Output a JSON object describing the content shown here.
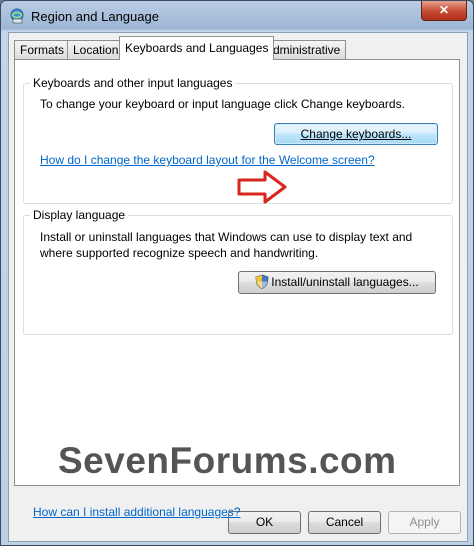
{
  "window": {
    "title": "Region and Language",
    "close_glyph": "✕"
  },
  "tabs": [
    {
      "label": "Formats",
      "active": false
    },
    {
      "label": "Location",
      "active": false
    },
    {
      "label": "Keyboards and Languages",
      "active": true
    },
    {
      "label": "Administrative",
      "active": false
    }
  ],
  "keyboards_group": {
    "legend": "Keyboards and other input languages",
    "description": "To change your keyboard or input language click Change keyboards.",
    "change_button": "Change keyboards...",
    "welcome_link": "How do I change the keyboard layout for the Welcome screen?"
  },
  "display_group": {
    "legend": "Display language",
    "description_line1": "Install or uninstall languages that Windows can use to display text and",
    "description_line2": "where supported recognize speech and handwriting.",
    "install_button": "Install/uninstall languages..."
  },
  "bottom_link": "How can I install additional languages?",
  "footer": {
    "ok": "OK",
    "cancel": "Cancel",
    "apply": "Apply"
  },
  "watermark": "SevenForums.com",
  "icons": {
    "title": "globe-keyboard-icon",
    "shield": "uac-shield-icon",
    "arrow": "red-arrow-icon"
  },
  "colors": {
    "link": "#0066cc",
    "arrow": "#d9261c",
    "close": "#c54a31"
  }
}
